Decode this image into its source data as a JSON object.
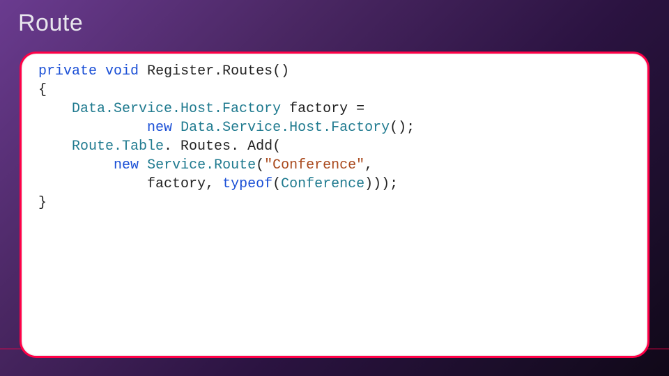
{
  "slide": {
    "title": "Route"
  },
  "code": {
    "l1": {
      "kw1": "private",
      "kw2": "void",
      "name": "Register.Routes()"
    },
    "l2": {
      "brace": "{"
    },
    "l3": {
      "type": "Data.Service.Host.Factory",
      "rest": " factory ="
    },
    "l4": {
      "kw": "new",
      "type": "Data.Service.Host.Factory",
      "rest": "();"
    },
    "l5": {
      "type": "Route.Table",
      "rest": ". Routes. Add("
    },
    "l6": {
      "kw": "new",
      "type": "Service.Route",
      "paren": "(",
      "str": "\"Conference\"",
      "comma": ","
    },
    "l7": {
      "lead": "factory, ",
      "kw": "typeof",
      "paren1": "(",
      "type": "Conference",
      "paren2": ")));"
    },
    "l8": {
      "brace": "}"
    }
  }
}
